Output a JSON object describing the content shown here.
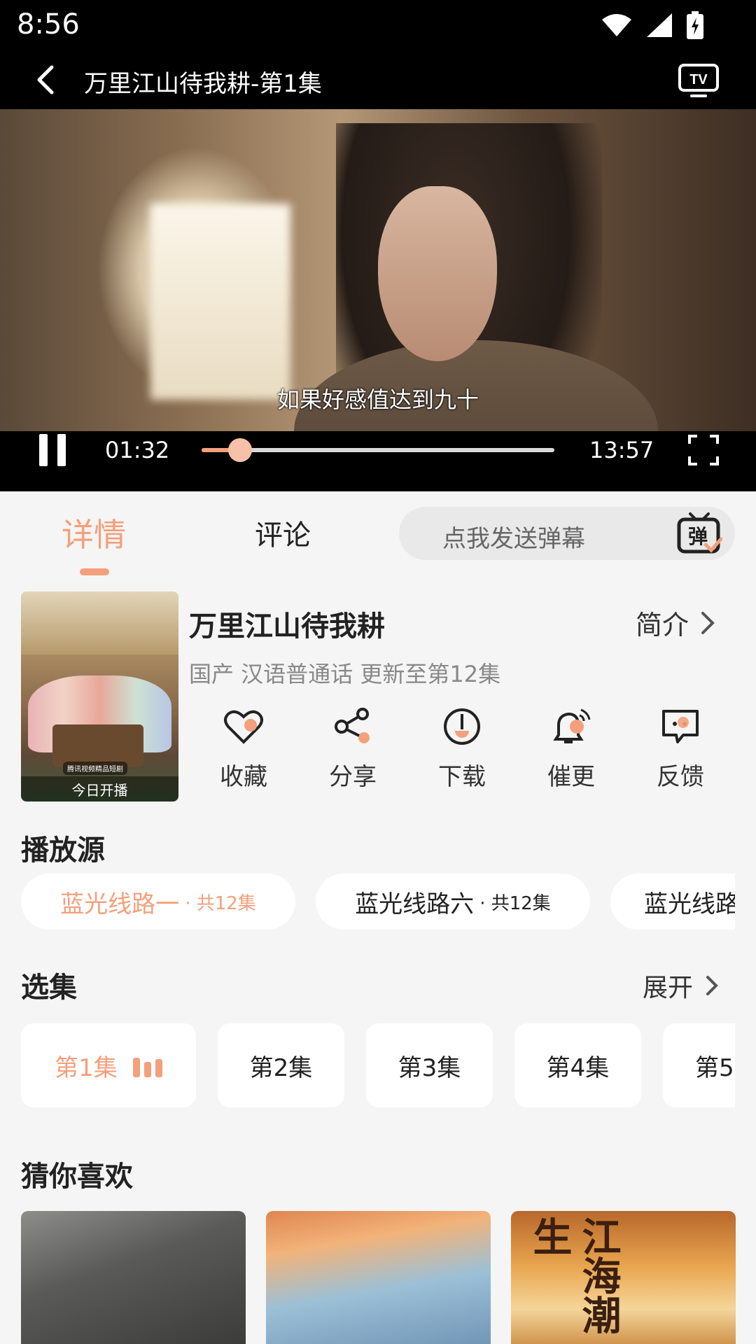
{
  "status_bar": {
    "time": "8:56"
  },
  "header": {
    "title": "万里江山待我耕-第1集"
  },
  "player": {
    "subtitle": "如果好感值达到九十",
    "current_time": "01:32",
    "total_time": "13:57",
    "progress": 0.11
  },
  "tabs": {
    "detail": "详情",
    "comment": "评论"
  },
  "danmu": {
    "placeholder": "点我发送弹幕",
    "icon_label": "弹"
  },
  "show": {
    "title": "万里江山待我耕",
    "intro_label": "简介",
    "meta": "国产 汉语普通话 更新至第12集",
    "poster_caption": "今日开播",
    "poster_brand": "腾讯视频精品短剧"
  },
  "actions": [
    {
      "label": "收藏",
      "icon": "heart-icon"
    },
    {
      "label": "分享",
      "icon": "share-icon"
    },
    {
      "label": "下载",
      "icon": "download-icon"
    },
    {
      "label": "催更",
      "icon": "bell-icon"
    },
    {
      "label": "反馈",
      "icon": "feedback-icon"
    }
  ],
  "sources": {
    "title": "播放源",
    "items": [
      {
        "name": "蓝光线路一",
        "count": "· 共12集",
        "active": true
      },
      {
        "name": "蓝光线路六",
        "count": "· 共12集",
        "active": false
      },
      {
        "name": "蓝光线路",
        "count": "",
        "active": false
      }
    ]
  },
  "episodes": {
    "title": "选集",
    "expand_label": "展开",
    "items": [
      "第1集",
      "第2集",
      "第3集",
      "第4集",
      "第5"
    ]
  },
  "recommend": {
    "title": "猜你喜欢",
    "card3_text": "江海潮生"
  },
  "colors": {
    "accent": "#f4a07c",
    "background": "#f5f5f5"
  }
}
